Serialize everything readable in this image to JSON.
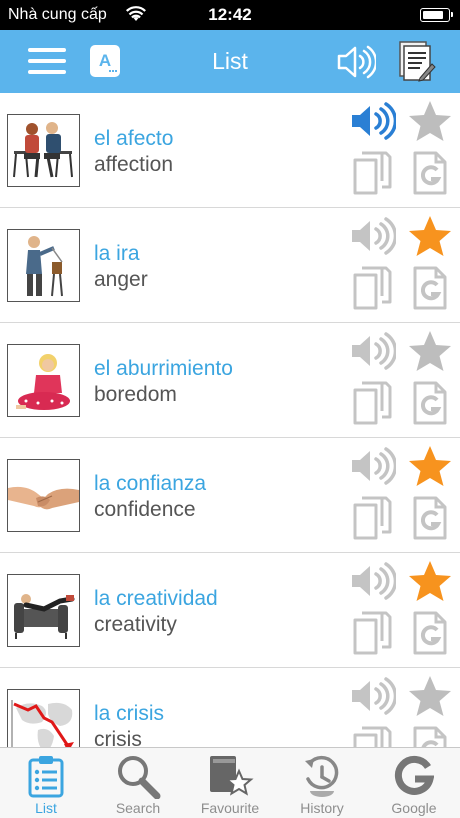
{
  "status_bar": {
    "carrier": "Nhà cung cấp",
    "time": "12:42",
    "battery_level": 0.85
  },
  "header": {
    "title": "List",
    "left_icons": [
      "menu-icon",
      "font-size-icon"
    ],
    "right_icons": [
      "speaker-icon",
      "notes-icon"
    ],
    "font_badge": "A"
  },
  "colors": {
    "accent": "#5bb4ec",
    "link_blue": "#3ba5e0",
    "star_orange": "#f7931e",
    "icon_gray": "#c4c4c4",
    "speaker_active": "#2a7fd4"
  },
  "words": [
    {
      "spanish": "el afecto",
      "english": "affection",
      "favourite": false,
      "playing": true
    },
    {
      "spanish": "la ira",
      "english": "anger",
      "favourite": true,
      "playing": false
    },
    {
      "spanish": "el aburrimiento",
      "english": "boredom",
      "favourite": false,
      "playing": false
    },
    {
      "spanish": "la confianza",
      "english": "confidence",
      "favourite": true,
      "playing": false
    },
    {
      "spanish": "la creatividad",
      "english": "creativity",
      "favourite": true,
      "playing": false
    },
    {
      "spanish": "la crisis",
      "english": "crisis",
      "favourite": false,
      "playing": false
    }
  ],
  "tabs": [
    {
      "label": "List",
      "icon": "list-icon",
      "active": true
    },
    {
      "label": "Search",
      "icon": "search-icon",
      "active": false
    },
    {
      "label": "Favourite",
      "icon": "favourite-icon",
      "active": false
    },
    {
      "label": "History",
      "icon": "history-icon",
      "active": false
    },
    {
      "label": "Google",
      "icon": "google-icon",
      "active": false
    }
  ]
}
